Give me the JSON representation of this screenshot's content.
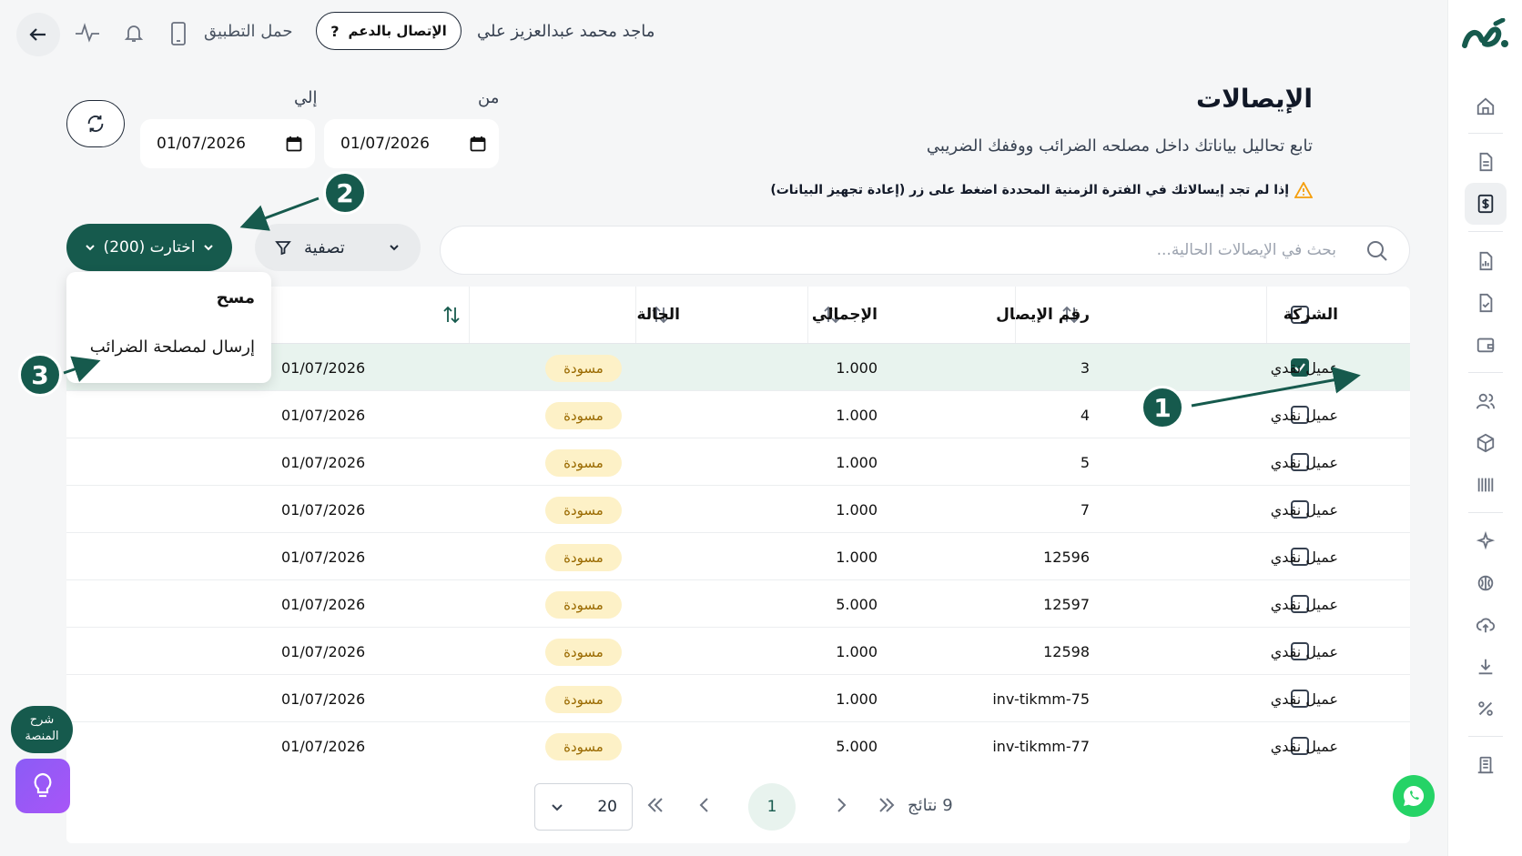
{
  "topbar": {
    "username": "ماجد محمد عبدالعزيز علي",
    "support_label": "الإتصال بالدعم",
    "app_label": "حمل التطبيق"
  },
  "header": {
    "title": "الإيصالات",
    "subtitle": "تابع تحاليل بياناتك داخل مصلحه الضرائب ووففك الضريبي",
    "warning": "إذا لم تجد إيسالاتك في الفترة الزمنية المحددة اضغط على زر (إعادة تجهيز البيانات)"
  },
  "date_filter": {
    "from_label": "من",
    "to_label": "إلي",
    "from_value": "01/07/2026",
    "to_value": "01/07/2026"
  },
  "toolbar": {
    "selected_label": "اختارت (200)",
    "filter_label": "تصفية",
    "search_placeholder": "بحث في الإيصالات الحالية..."
  },
  "dropdown": {
    "items": [
      "مسح",
      "إرسال لمصلحة الضرائب"
    ]
  },
  "table": {
    "columns": {
      "company": "الشركة",
      "receipt_no": "رقم الإيصال",
      "total": "الإجمالي",
      "status": "الحالة"
    },
    "rows": [
      {
        "company": "عميل نقدي",
        "receipt_no": "3",
        "total": "1.000",
        "status": "مسودة",
        "date": "01/07/2026"
      },
      {
        "company": "عميل نقدي",
        "receipt_no": "4",
        "total": "1.000",
        "status": "مسودة",
        "date": "01/07/2026"
      },
      {
        "company": "عميل نقدي",
        "receipt_no": "5",
        "total": "1.000",
        "status": "مسودة",
        "date": "01/07/2026"
      },
      {
        "company": "عميل نقدي",
        "receipt_no": "7",
        "total": "1.000",
        "status": "مسودة",
        "date": "01/07/2026"
      },
      {
        "company": "عميل نقدي",
        "receipt_no": "12596",
        "total": "1.000",
        "status": "مسودة",
        "date": "01/07/2026"
      },
      {
        "company": "عميل نقدي",
        "receipt_no": "12597",
        "total": "5.000",
        "status": "مسودة",
        "date": "01/07/2026"
      },
      {
        "company": "عميل نقدي",
        "receipt_no": "12598",
        "total": "1.000",
        "status": "مسودة",
        "date": "01/07/2026"
      },
      {
        "company": "عميل نقدي",
        "receipt_no": "inv-tikmm-75",
        "total": "1.000",
        "status": "مسودة",
        "date": "01/07/2026"
      },
      {
        "company": "عميل نقدي",
        "receipt_no": "inv-tikmm-77",
        "total": "5.000",
        "status": "مسودة",
        "date": "01/07/2026"
      }
    ]
  },
  "pagination": {
    "results_label": "9 نتائج",
    "current_page": "1",
    "page_size": "20"
  },
  "annotations": [
    "1",
    "2",
    "3"
  ],
  "help": {
    "label_line1": "شرح",
    "label_line2": "المنصة"
  },
  "colors": {
    "brand": "#165a4d",
    "badge_bg": "#fdf1c7",
    "badge_text": "#9a6a00",
    "selected_row": "#e8f3ee",
    "warning": "#f59e0b"
  },
  "icons": [
    "back-arrow-icon",
    "activity-icon",
    "bell-icon",
    "phone-icon",
    "question-icon",
    "refresh-icon",
    "calendar-icon",
    "chevron-down-icon",
    "filter-icon",
    "search-icon",
    "sort-icon",
    "check-icon",
    "warning-icon",
    "whatsapp-icon",
    "lightbulb-icon"
  ]
}
